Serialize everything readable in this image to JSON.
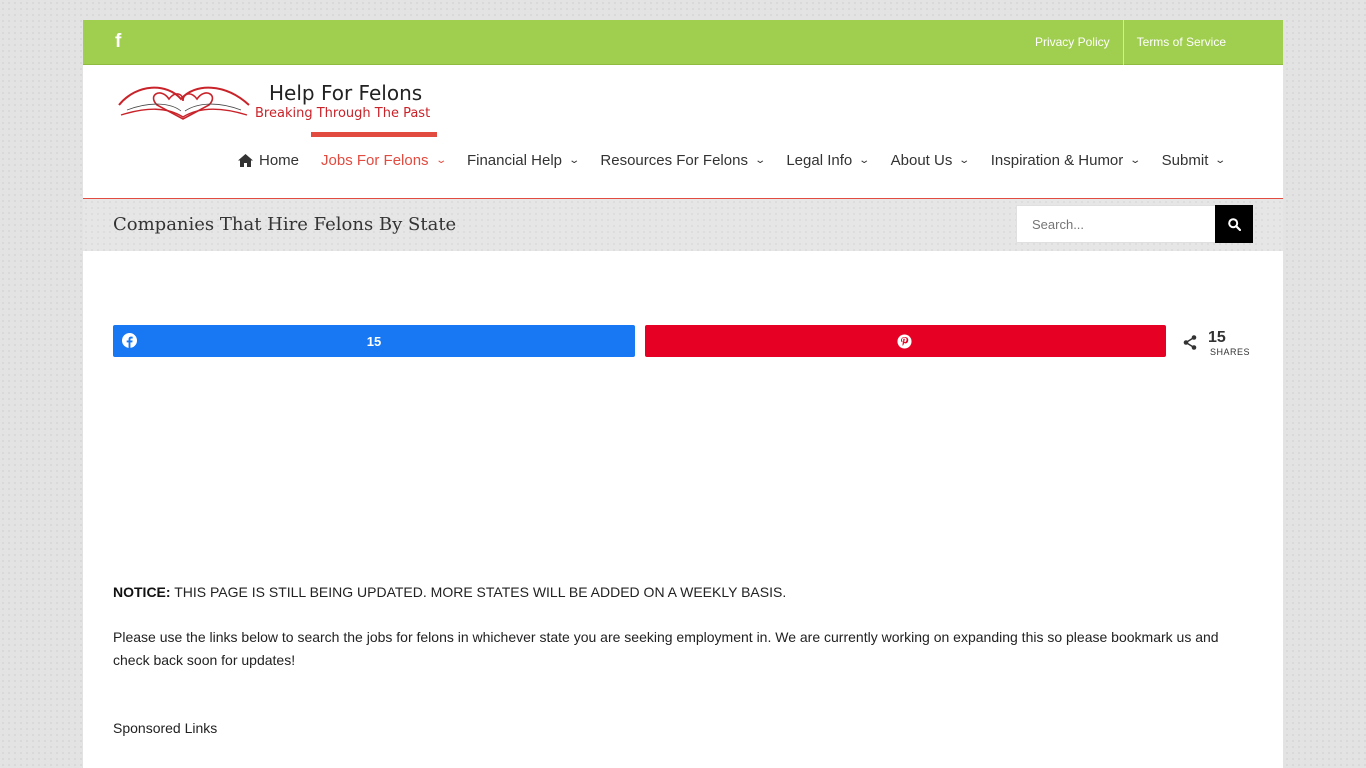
{
  "topbar": {
    "social_icon": "facebook-icon",
    "links": [
      "Privacy Policy",
      "Terms of Service"
    ]
  },
  "logo": {
    "title": "Help For Felons",
    "subtitle": "Breaking Through The Past"
  },
  "nav": {
    "items": [
      {
        "label": "Home",
        "icon": "home-icon"
      },
      {
        "label": "Jobs For Felons"
      },
      {
        "label": "Financial Help"
      },
      {
        "label": "Resources For Felons"
      },
      {
        "label": "Legal Info"
      },
      {
        "label": "About Us"
      },
      {
        "label": "Inspiration & Humor"
      },
      {
        "label": "Submit"
      }
    ]
  },
  "titlebar": {
    "title": "Companies That Hire Felons By State",
    "search_placeholder": "Search..."
  },
  "share": {
    "facebook_count": "15",
    "total_count": "15",
    "total_label": "SHARES"
  },
  "content": {
    "notice_label": "NOTICE:",
    "notice_text": " THIS PAGE IS STILL BEING UPDATED. MORE STATES WILL BE ADDED ON A WEEKLY BASIS.",
    "paragraph": "Please use the links below to search the jobs for felons in whichever state you are seeking employment in. We are currently working on expanding this so please bookmark us and check back soon for updates!",
    "sponsored": "Sponsored Links"
  },
  "colors": {
    "topbar": "#a0ce4e",
    "accent": "#e24b3f",
    "facebook": "#1877f2",
    "pinterest": "#e60023"
  }
}
